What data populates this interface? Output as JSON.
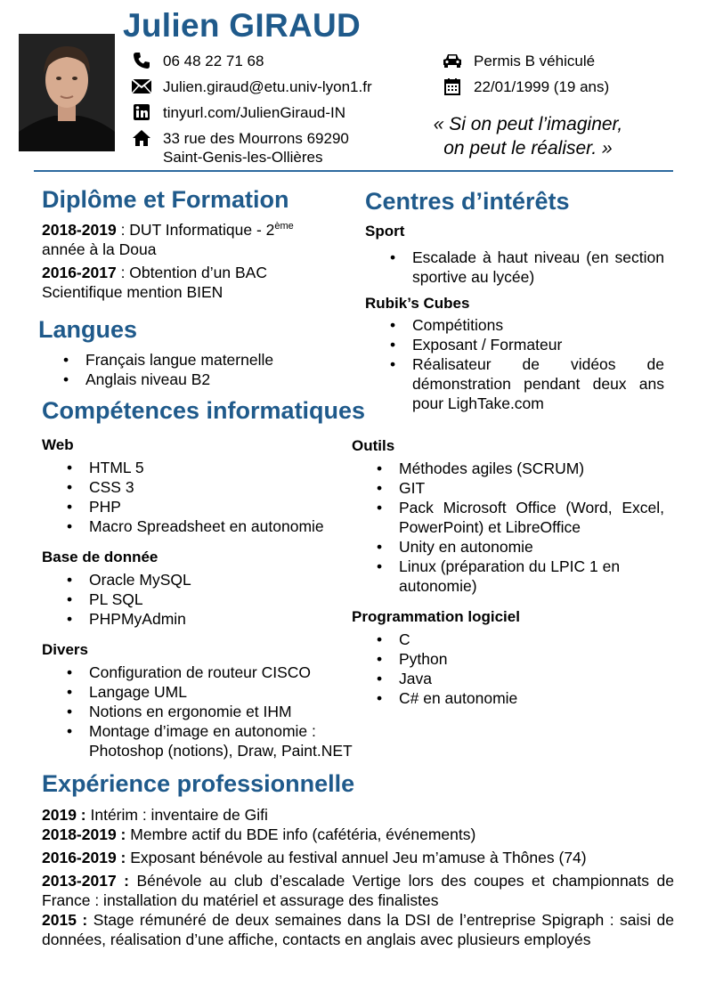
{
  "header": {
    "name": "Julien GIRAUD",
    "quote_line1": "« Si on peut l’imaginer,",
    "quote_line2": "on peut le réaliser. »",
    "contacts": [
      {
        "icon": "phone-icon",
        "text": "06 48 22 71 68"
      },
      {
        "icon": "envelope-icon",
        "text": "Julien.giraud@etu.univ-lyon1.fr"
      },
      {
        "icon": "linkedin-icon",
        "text": "tinyurl.com/JulienGiraud-IN"
      },
      {
        "icon": "home-icon",
        "line1": "33 rue des Mourrons 69290",
        "line2": "Saint-Genis-les-Ollières"
      }
    ],
    "contacts_right": [
      {
        "icon": "car-icon",
        "text": "Permis B véhiculé"
      },
      {
        "icon": "calendar-icon",
        "text": "22/01/1999 (19 ans)"
      }
    ]
  },
  "formation": {
    "title": "Diplôme et Formation",
    "entries": [
      {
        "year": "2018-2019",
        "text": " : DUT Informatique - 2",
        "sup": "ème",
        "text2": "année à la Doua"
      },
      {
        "year": "2016-2017",
        "text": " : Obtention d’un BAC",
        "text2": "Scientifique mention BIEN"
      }
    ]
  },
  "langues": {
    "title": "Langues",
    "items": [
      "Français langue maternelle",
      "Anglais niveau B2"
    ]
  },
  "competences": {
    "title": "Compétences informatiques",
    "web": {
      "title": "Web",
      "items": [
        "HTML 5",
        "CSS 3",
        "PHP",
        "Macro Spreadsheet en autonomie"
      ]
    },
    "bdd": {
      "title": "Base de donnée",
      "items": [
        "Oracle MySQL",
        "PL SQL",
        "PHPMyAdmin"
      ]
    },
    "divers": {
      "title": "Divers",
      "items": [
        "Configuration de routeur CISCO",
        "Langage UML",
        "Notions en ergonomie et IHM",
        "Montage d’image en autonomie :",
        "Photoshop (notions), Draw, Paint.NET"
      ]
    },
    "outils": {
      "title": "Outils",
      "items": [
        "Méthodes agiles (SCRUM)",
        "GIT",
        "Pack Microsoft Office (Word, Excel, PowerPoint) et LibreOffice",
        "Unity en autonomie",
        "Linux (préparation du LPIC 1 en autonomie)"
      ]
    },
    "prog": {
      "title": "Programmation logiciel",
      "items": [
        "C",
        "Python",
        "Java",
        "C# en autonomie"
      ]
    }
  },
  "interets": {
    "title": "Centres d’intérêts",
    "sport": {
      "title": "Sport",
      "items": [
        "Escalade à haut niveau (en section sportive au lycée)"
      ]
    },
    "rubik": {
      "title": "Rubik’s Cubes",
      "items": [
        "Compétitions",
        "Exposant / Formateur",
        "Réalisateur de vidéos de démonstration pendant deux ans pour LighTake.com"
      ]
    }
  },
  "experience": {
    "title": "Expérience professionnelle",
    "entries": [
      {
        "year": "2019 :",
        "text": " Intérim : inventaire de Gifi"
      },
      {
        "year": "2018-2019 :",
        "text": " Membre actif du BDE info (cafétéria, événements)"
      },
      {
        "year": "2016-2019 :",
        "text": " Exposant bénévole au festival annuel Jeu m’amuse à Thônes (74)"
      },
      {
        "year": "2013-2017 :",
        "text": " Bénévole au club d’escalade Vertige lors des coupes et championnats de France : installation du matériel et assurage des finalistes"
      },
      {
        "year": "2015 :",
        "text": " Stage rémunéré de deux semaines dans la DSI de l’entreprise Spigraph : saisi de données, réalisation d’une affiche, contacts en anglais avec plusieurs employés"
      }
    ]
  }
}
